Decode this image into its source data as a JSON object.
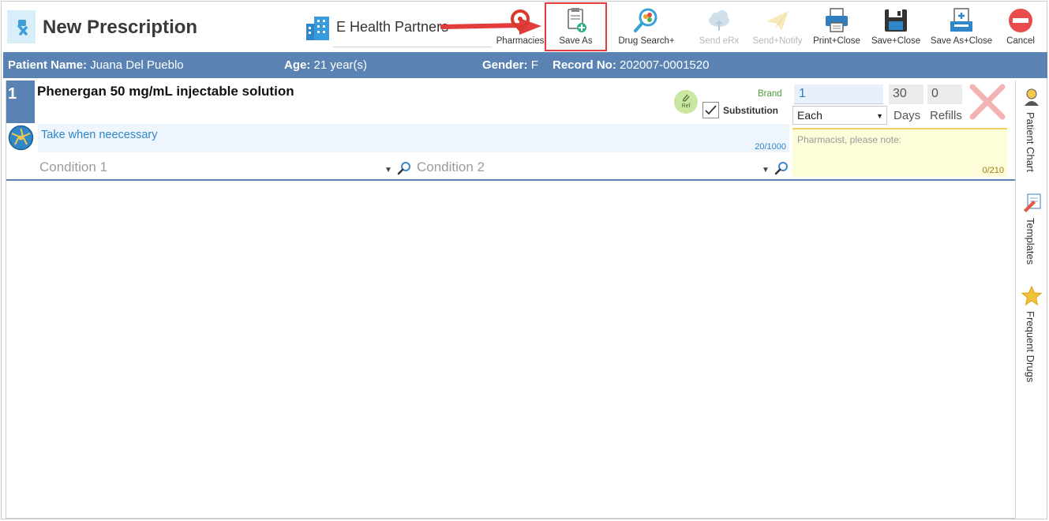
{
  "header": {
    "title": "New Prescription",
    "organization": "E Health Partners"
  },
  "toolbar": {
    "pharmacies": "Pharmacies",
    "save_as": "Save As",
    "drug_search": "Drug Search+",
    "send_erx": "Send eRx",
    "send_notify": "Send+Notify",
    "print_close": "Print+Close",
    "save_close": "Save+Close",
    "save_as_close": "Save As+Close",
    "cancel": "Cancel"
  },
  "patient": {
    "name_label": "Patient Name:",
    "name": "Juana Del Pueblo",
    "age_label": "Age:",
    "age": "21 year(s)",
    "gender_label": "Gender:",
    "gender": "F",
    "record_label": "Record No:",
    "record": "202007-0001520"
  },
  "prescription": {
    "number": "1",
    "drug": "Phenergan 50 mg/mL injectable solution",
    "ref_label": "Ref",
    "brand_label": "Brand",
    "substitution_label": "Substitution",
    "substitution_checked": true,
    "sig": "Take when neecessary",
    "sig_count": "20/1000",
    "condition1_placeholder": "Condition 1",
    "condition2_placeholder": "Condition 2",
    "quantity": "1",
    "unit": "Each",
    "days": "30",
    "days_label": "Days",
    "refills": "0",
    "refills_label": "Refills",
    "pharmacist_note_placeholder": "Pharmacist, please note:",
    "pharmacist_note_count": "0/210"
  },
  "side_panel": {
    "patient_chart": "Patient Chart",
    "templates": "Templates",
    "frequent_drugs": "Frequent Drugs"
  },
  "colors": {
    "accent_blue": "#5a83b3",
    "highlight_red": "#e23c3c",
    "sig_text": "#2f86c8"
  }
}
